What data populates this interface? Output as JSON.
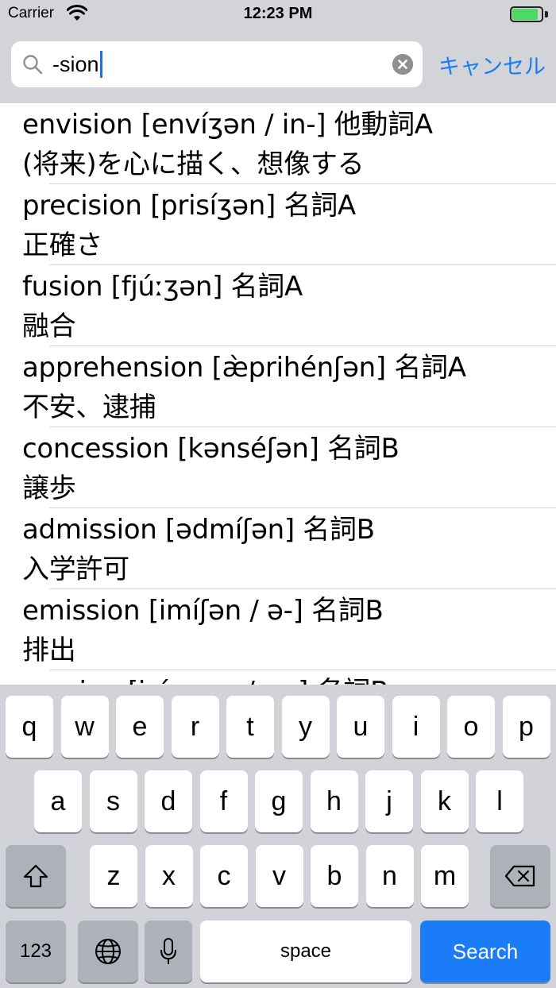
{
  "status_bar": {
    "carrier": "Carrier",
    "time": "12:23 PM",
    "battery_level": 0.95,
    "battery_color": "#4cd964"
  },
  "search": {
    "query": "-sion",
    "cancel_label": "キャンセル"
  },
  "results": [
    {
      "line1": "envision [envíʒən / in-] 他動詞A",
      "line2": "(将来)を心に描く、想像する"
    },
    {
      "line1": "precision [prisíʒən] 名詞A",
      "line2": "正確さ"
    },
    {
      "line1": "fusion [fjúːʒən] 名詞A",
      "line2": "融合"
    },
    {
      "line1": "apprehension [æ̀prihénʃən] 名詞A",
      "line2": "不安、逮捕"
    },
    {
      "line1": "concession [kənséʃən] 名詞B",
      "line2": "譲歩"
    },
    {
      "line1": "admission [ədmíʃən] 名詞B",
      "line2": "入学許可"
    },
    {
      "line1": "emission [imíʃən / ə-] 名詞B",
      "line2": "排出"
    },
    {
      "line1": "erosion [iróuʒən / ər-] 名詞B",
      "line2": ""
    }
  ],
  "keyboard": {
    "row1": [
      "q",
      "w",
      "e",
      "r",
      "t",
      "y",
      "u",
      "i",
      "o",
      "p"
    ],
    "row2": [
      "a",
      "s",
      "d",
      "f",
      "g",
      "h",
      "j",
      "k",
      "l"
    ],
    "row3": [
      "z",
      "x",
      "c",
      "v",
      "b",
      "n",
      "m"
    ],
    "numbers_label": "123",
    "space_label": "space",
    "search_label": "Search",
    "accent_color": "#1a7cf6"
  }
}
